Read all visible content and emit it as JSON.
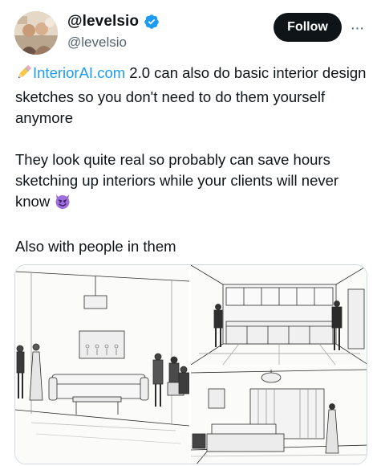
{
  "author": {
    "display_name": "@levelsio",
    "handle": "@levelsio",
    "verified": true,
    "avatar_icon": "avatar-photo"
  },
  "actions": {
    "follow_label": "Follow",
    "more_icon": "more-icon",
    "more_glyph": "···"
  },
  "tweet": {
    "pencil_emoji": "pencil-icon",
    "link_text": "InteriorAI.com",
    "line1_rest": " 2.0 can also do basic interior design sketches so you don't need to do them yourself anymore",
    "para2": "They look quite real so probably can save hours sketching up interiors while your clients will never know",
    "devil_emoji": "smiling-devil-icon",
    "para3": "Also with people in them"
  },
  "media": {
    "images": [
      {
        "name": "living-room-sketch"
      },
      {
        "name": "kitchen-sketch"
      },
      {
        "name": "bedroom-sketch"
      }
    ]
  },
  "colors": {
    "link": "#1d9bf0",
    "verified": "#1d9bf0",
    "follow_bg": "#0f1419",
    "secondary_text": "#536471"
  }
}
